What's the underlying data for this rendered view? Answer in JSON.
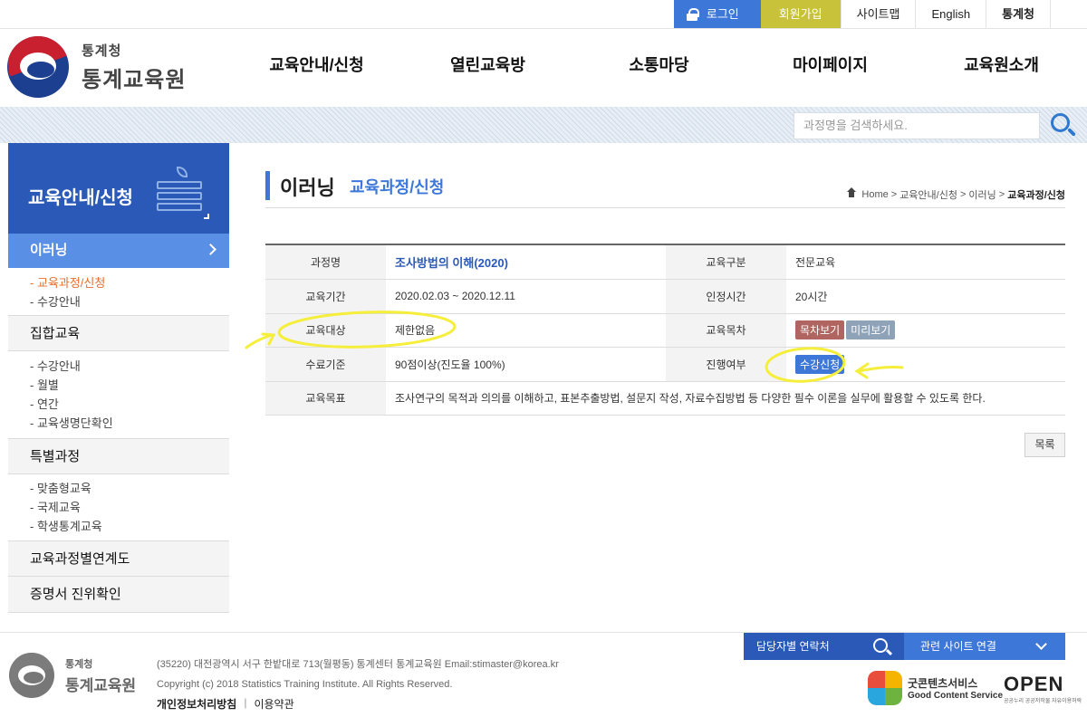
{
  "util": {
    "login": "로그인",
    "join": "회원가입",
    "sitemap": "사이트맵",
    "english": "English",
    "kostat": "통계청"
  },
  "logo": {
    "small": "통계청",
    "big": "통계교육원"
  },
  "gnb": [
    "교육안내/신청",
    "열린교육방",
    "소통마당",
    "마이페이지",
    "교육원소개"
  ],
  "search": {
    "placeholder": "과정명을 검색하세요."
  },
  "sidebar": {
    "title": "교육안내/신청",
    "active": "이러닝",
    "active_sub": [
      "- 교육과정/신청",
      "- 수강안내"
    ],
    "sections": [
      {
        "label": "집합교육",
        "items": [
          "- 수강안내",
          "- 월별",
          "- 연간",
          "- 교육생명단확인"
        ]
      },
      {
        "label": "특별과정",
        "items": [
          "- 맞춤형교육",
          "- 국제교육",
          "- 학생통계교육"
        ]
      },
      {
        "label": "교육과정별연계도",
        "items": []
      },
      {
        "label": "증명서 진위확인",
        "items": []
      }
    ]
  },
  "page": {
    "title": "이러닝",
    "subtitle": "교육과정/신청",
    "breadcrumb": [
      "Home",
      "교육안내/신청",
      "이러닝",
      "교육과정/신청"
    ]
  },
  "course": {
    "h_name": "과정명",
    "name": "조사방법의 이해(2020)",
    "h_type": "교육구분",
    "type": "전문교육",
    "h_period": "교육기간",
    "period": "2020.02.03 ~ 2020.12.11",
    "h_hours": "인정시간",
    "hours": "20시간",
    "h_target": "교육대상",
    "target": "제한없음",
    "h_toc": "교육목차",
    "toc_btn": "목차보기",
    "preview_btn": "미리보기",
    "h_criteria": "수료기준",
    "criteria": "90점이상(진도율 100%)",
    "h_status": "진행여부",
    "status_btn": "수강신청",
    "h_goal": "교육목표",
    "goal": "조사연구의 목적과 의의를 이해하고, 표본추출방법, 설문지 작성, 자료수집방법 등 다양한 필수 이론을 실무에 활용할 수 있도록 한다."
  },
  "list_btn": "목록",
  "footer": {
    "logo_small": "통계청",
    "logo_big": "통계교육원",
    "address": "(35220) 대전광역시 서구 한밭대로 713(월평동) 통계센터 통계교육원 Email:stimaster@korea.kr",
    "copyright": "Copyright (c) 2018 Statistics Training Institute. All Rights Reserved.",
    "privacy": "개인정보처리방침",
    "terms": "이용약관",
    "contact": "담당자별 연락처",
    "related": "관련 사이트 연결",
    "gcs_ko": "굿콘텐츠서비스",
    "gcs_en": "Good Content Service",
    "open": "OPEN",
    "open_sub": "공공누리 공공저작물 자유이용허락"
  },
  "colors": {
    "brand_blue": "#2a59b8",
    "accent_blue": "#3d78d8",
    "join_yellow": "#c8c13a",
    "highlight": "#f5ee3a"
  }
}
